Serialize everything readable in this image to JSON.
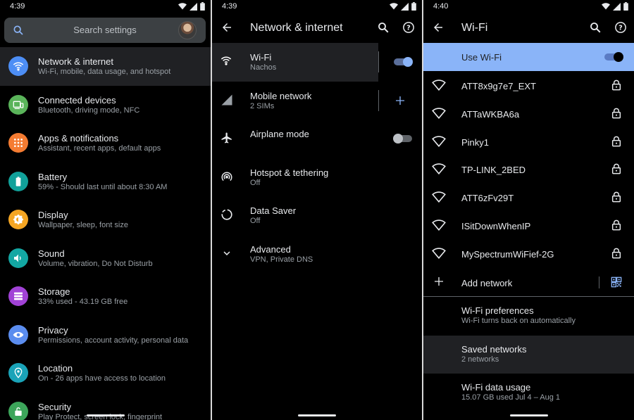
{
  "colors": {
    "accent": "#8ab4f8",
    "background": "#000000",
    "surface": "#202124",
    "search_bg": "#3c4043"
  },
  "panel1": {
    "status": {
      "time": "4:39"
    },
    "search": {
      "placeholder": "Search settings"
    },
    "items": [
      {
        "title": "Network & internet",
        "subtitle": "Wi-Fi, mobile, data usage, and hotspot",
        "icon": "wifi-icon",
        "color": "#4d8ef5"
      },
      {
        "title": "Connected devices",
        "subtitle": "Bluetooth, driving mode, NFC",
        "icon": "devices-icon",
        "color": "#5ab45a"
      },
      {
        "title": "Apps & notifications",
        "subtitle": "Assistant, recent apps, default apps",
        "icon": "apps-grid-icon",
        "color": "#f57c32"
      },
      {
        "title": "Battery",
        "subtitle": "59% - Should last until about 8:30 AM",
        "icon": "battery-icon",
        "color": "#11a19a"
      },
      {
        "title": "Display",
        "subtitle": "Wallpaper, sleep, font size",
        "icon": "display-brightness-icon",
        "color": "#f5a623"
      },
      {
        "title": "Sound",
        "subtitle": "Volume, vibration, Do Not Disturb",
        "icon": "volume-icon",
        "color": "#13a7a3"
      },
      {
        "title": "Storage",
        "subtitle": "33% used - 43.19 GB free",
        "icon": "storage-icon",
        "color": "#a142d6"
      },
      {
        "title": "Privacy",
        "subtitle": "Permissions, account activity, personal data",
        "icon": "eye-icon",
        "color": "#5b8def"
      },
      {
        "title": "Location",
        "subtitle": "On - 26 apps have access to location",
        "icon": "location-pin-icon",
        "color": "#1aa3b8"
      },
      {
        "title": "Security",
        "subtitle": "Play Protect, screen lock, fingerprint",
        "icon": "lock-open-icon",
        "color": "#3ca55a"
      }
    ]
  },
  "panel2": {
    "status": {
      "time": "4:39"
    },
    "title": "Network & internet",
    "items": [
      {
        "title": "Wi-Fi",
        "subtitle": "Nachos",
        "icon": "wifi-icon",
        "toggle": "on"
      },
      {
        "title": "Mobile network",
        "subtitle": "2 SIMs",
        "icon": "cell-signal-icon",
        "action": "add"
      },
      {
        "title": "Airplane mode",
        "subtitle": "",
        "icon": "airplane-icon",
        "toggle": "off"
      },
      {
        "title": "Hotspot & tethering",
        "subtitle": "Off",
        "icon": "hotspot-icon"
      },
      {
        "title": "Data Saver",
        "subtitle": "Off",
        "icon": "data-saver-icon"
      },
      {
        "title": "Advanced",
        "subtitle": "VPN, Private DNS",
        "icon": "chevron-down-icon"
      }
    ]
  },
  "panel3": {
    "status": {
      "time": "4:40"
    },
    "title": "Wi-Fi",
    "use_wifi": {
      "label": "Use Wi-Fi",
      "toggle": "on"
    },
    "networks": [
      {
        "ssid": "ATT8x9g7e7_EXT",
        "secured": true
      },
      {
        "ssid": "ATTaWKBA6a",
        "secured": true
      },
      {
        "ssid": "Pinky1",
        "secured": true
      },
      {
        "ssid": "TP-LINK_2BED",
        "secured": true
      },
      {
        "ssid": "ATT6zFv29T",
        "secured": true
      },
      {
        "ssid": "ISitDownWhenIP",
        "secured": true
      },
      {
        "ssid": "MySpectrumWiFief-2G",
        "secured": true
      }
    ],
    "add_network": "Add network",
    "prefs": [
      {
        "title": "Wi-Fi preferences",
        "subtitle": "Wi-Fi turns back on automatically"
      },
      {
        "title": "Saved networks",
        "subtitle": "2 networks"
      },
      {
        "title": "Wi-Fi data usage",
        "subtitle": "15.07 GB used Jul 4 – Aug 1"
      }
    ]
  }
}
